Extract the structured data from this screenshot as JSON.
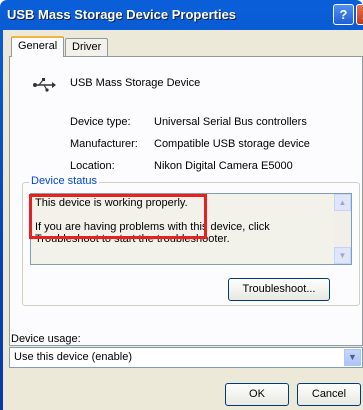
{
  "window": {
    "title": "USB Mass Storage Device Properties",
    "help_label": "?",
    "close_label": "X"
  },
  "tabs": [
    {
      "label": "General",
      "active": true
    },
    {
      "label": "Driver",
      "active": false
    }
  ],
  "device": {
    "icon": "usb-icon",
    "name": "USB Mass Storage Device",
    "properties": [
      {
        "label": "Device type:",
        "value": "Universal Serial Bus controllers"
      },
      {
        "label": "Manufacturer:",
        "value": "Compatible USB storage device"
      },
      {
        "label": "Location:",
        "value": "Nikon Digital Camera E5000"
      }
    ]
  },
  "status": {
    "legend": "Device status",
    "text": "This device is working properly.\n\nIf you are having problems with this device, click Troubleshoot to start the troubleshooter.",
    "troubleshoot_label": "Troubleshoot..."
  },
  "usage": {
    "label": "Device usage:",
    "selected": "Use this device (enable)"
  },
  "buttons": {
    "ok": "OK",
    "cancel": "Cancel"
  },
  "colors": {
    "highlight": "#e8201f",
    "accent": "#0046d5"
  }
}
